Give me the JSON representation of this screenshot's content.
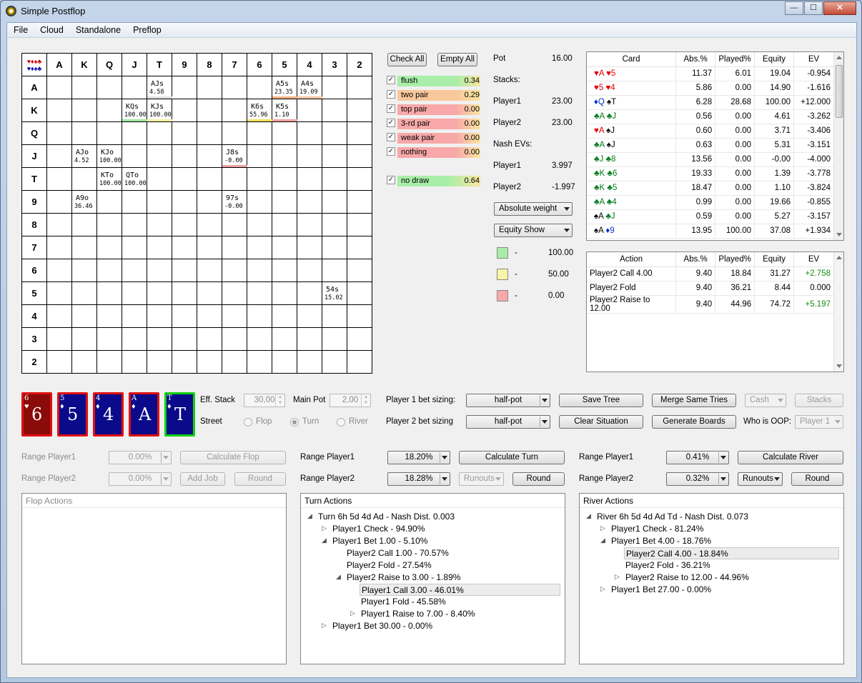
{
  "window": {
    "title": "Simple Postflop",
    "min": "—",
    "max": "☐",
    "close": "✕"
  },
  "menu": [
    "File",
    "Cloud",
    "Standalone",
    "Preflop"
  ],
  "grid": {
    "ranks": [
      "A",
      "K",
      "Q",
      "J",
      "T",
      "9",
      "8",
      "7",
      "6",
      "5",
      "4",
      "3",
      "2"
    ],
    "corner_suits": [
      "♥♦♠♣",
      "♥♦♠♣"
    ],
    "cells": [
      {
        "r": 0,
        "c": 4,
        "name": "AJs",
        "val": "4.58",
        "bar": "#e0e0e0"
      },
      {
        "r": 0,
        "c": 9,
        "name": "A5s",
        "val": "23.35",
        "bar": "#f6b080"
      },
      {
        "r": 0,
        "c": 10,
        "name": "A4s",
        "val": "19.09",
        "bar": "#f8c4a0"
      },
      {
        "r": 1,
        "c": 3,
        "name": "KQs",
        "val": "100.00",
        "bar": "#a0e8a0"
      },
      {
        "r": 1,
        "c": 4,
        "name": "KJs",
        "val": "100.00",
        "bar": "#f6f0a0"
      },
      {
        "r": 1,
        "c": 8,
        "name": "K6s",
        "val": "55.96",
        "bar": "#f0e060"
      },
      {
        "r": 1,
        "c": 9,
        "name": "K5s",
        "val": "1.10",
        "bar": "#f0a0a0"
      },
      {
        "r": 3,
        "c": 1,
        "name": "AJo",
        "val": "4.52",
        "bar": ""
      },
      {
        "r": 3,
        "c": 2,
        "name": "KJo",
        "val": "100.00",
        "bar": ""
      },
      {
        "r": 3,
        "c": 7,
        "name": "J8s",
        "val": "-0.00",
        "bar": "#f0a0a0"
      },
      {
        "r": 4,
        "c": 2,
        "name": "KTo",
        "val": "100.00",
        "bar": ""
      },
      {
        "r": 4,
        "c": 3,
        "name": "QTo",
        "val": "100.00",
        "bar": ""
      },
      {
        "r": 5,
        "c": 1,
        "name": "A9o",
        "val": "36.46",
        "bar": ""
      },
      {
        "r": 5,
        "c": 7,
        "name": "97s",
        "val": "-0.00",
        "bar": ""
      },
      {
        "r": 9,
        "c": 11,
        "name": "54s",
        "val": "15.02",
        "bar": ""
      }
    ]
  },
  "filters": {
    "check_all": "Check All",
    "empty_all": "Empty All",
    "items": [
      {
        "label": "flush",
        "value": "0.34",
        "color": "#a8eea8"
      },
      {
        "label": "two pair",
        "value": "0.29",
        "color": "#f8c89c"
      },
      {
        "label": "top pair",
        "value": "0.00",
        "color": "#f8a8a8"
      },
      {
        "label": "3-rd pair",
        "value": "0.00",
        "color": "#f8a8a8"
      },
      {
        "label": "weak pair",
        "value": "0.00",
        "color": "#f8a8a8"
      },
      {
        "label": "nothing",
        "value": "0.00",
        "color": "#f8a8a8"
      }
    ],
    "draw": {
      "label": "no draw",
      "value": "0.64",
      "color": "#a8eea8"
    }
  },
  "info": {
    "pot_label": "Pot",
    "pot": "16.00",
    "stacks_label": "Stacks:",
    "p1_label": "Player1",
    "p1_stack": "23.00",
    "p2_label": "Player2",
    "p2_stack": "23.00",
    "nash_label": "Nash EVs:",
    "p1_nash": "3.997",
    "p2_nash": "-1.997",
    "weight_select": "Absolute weight",
    "equity_select": "Equity Show",
    "legend": [
      {
        "color": "#a8eea8",
        "dash": "-",
        "value": "100.00"
      },
      {
        "color": "#f8f4a8",
        "dash": "-",
        "value": "50.00"
      },
      {
        "color": "#f8a8a8",
        "dash": "-",
        "value": "0.00"
      }
    ]
  },
  "card_table": {
    "headers": [
      "Card",
      "Abs.%",
      "Played%",
      "Equity",
      "EV"
    ],
    "rows": [
      {
        "c1": "♥A",
        "c1c": "red",
        "c2": "♥5",
        "c2c": "red",
        "abs": "11.37",
        "played": "6.01",
        "equity": "19.04",
        "ev": "-0.954"
      },
      {
        "c1": "♥5",
        "c1c": "red",
        "c2": "♥4",
        "c2c": "red",
        "abs": "5.86",
        "played": "0.00",
        "equity": "14.90",
        "ev": "-1.616"
      },
      {
        "c1": "♦Q",
        "c1c": "blu",
        "c2": "♠T",
        "c2c": "blk",
        "abs": "6.28",
        "played": "28.68",
        "equity": "100.00",
        "ev": "+12.000"
      },
      {
        "c1": "♣A",
        "c1c": "grn",
        "c2": "♣J",
        "c2c": "grn",
        "abs": "0.56",
        "played": "0.00",
        "equity": "4.61",
        "ev": "-3.262"
      },
      {
        "c1": "♥A",
        "c1c": "red",
        "c2": "♠J",
        "c2c": "blk",
        "abs": "0.60",
        "played": "0.00",
        "equity": "3.71",
        "ev": "-3.406"
      },
      {
        "c1": "♣A",
        "c1c": "grn",
        "c2": "♠J",
        "c2c": "blk",
        "abs": "0.63",
        "played": "0.00",
        "equity": "5.31",
        "ev": "-3.151"
      },
      {
        "c1": "♣J",
        "c1c": "grn",
        "c2": "♣8",
        "c2c": "grn",
        "abs": "13.56",
        "played": "0.00",
        "equity": "-0.00",
        "ev": "-4.000"
      },
      {
        "c1": "♣K",
        "c1c": "grn",
        "c2": "♣6",
        "c2c": "grn",
        "abs": "19.33",
        "played": "0.00",
        "equity": "1.39",
        "ev": "-3.778"
      },
      {
        "c1": "♣K",
        "c1c": "grn",
        "c2": "♣5",
        "c2c": "grn",
        "abs": "18.47",
        "played": "0.00",
        "equity": "1.10",
        "ev": "-3.824"
      },
      {
        "c1": "♣A",
        "c1c": "grn",
        "c2": "♣4",
        "c2c": "grn",
        "abs": "0.99",
        "played": "0.00",
        "equity": "19.66",
        "ev": "-0.855"
      },
      {
        "c1": "♠A",
        "c1c": "blk",
        "c2": "♣J",
        "c2c": "grn",
        "abs": "0.59",
        "played": "0.00",
        "equity": "5.27",
        "ev": "-3.157"
      },
      {
        "c1": "♠A",
        "c1c": "blk",
        "c2": "♦9",
        "c2c": "blu",
        "abs": "13.95",
        "played": "100.00",
        "equity": "37.08",
        "ev": "+1.934"
      }
    ]
  },
  "action_table": {
    "headers": [
      "Action",
      "Abs.%",
      "Played%",
      "Equity",
      "EV"
    ],
    "rows": [
      {
        "action": "Player2 Call 4.00",
        "abs": "9.40",
        "played": "18.84",
        "equity": "31.27",
        "ev": "+2.758",
        "pos": true
      },
      {
        "action": "Player2 Fold",
        "abs": "9.40",
        "played": "36.21",
        "equity": "8.44",
        "ev": "0.000",
        "pos": false
      },
      {
        "action": "Player2 Raise to 12.00",
        "abs": "9.40",
        "played": "44.96",
        "equity": "74.72",
        "ev": "+5.197",
        "pos": true
      }
    ]
  },
  "board": [
    {
      "rank": "6",
      "suit": "♥",
      "big": "6",
      "bg": "#8b0a0a",
      "border": "#e01010"
    },
    {
      "rank": "5",
      "suit": "♦",
      "big": "5",
      "bg": "#0a0a8b",
      "border": "#e01010"
    },
    {
      "rank": "4",
      "suit": "♦",
      "big": "4",
      "bg": "#0a0a8b",
      "border": "#e01010"
    },
    {
      "rank": "A",
      "suit": "♦",
      "big": "A",
      "bg": "#0a0a8b",
      "border": "#e01010"
    },
    {
      "rank": "T",
      "suit": "♦",
      "big": "T",
      "bg": "#0a0a8b",
      "border": "#10d010"
    }
  ],
  "controls": {
    "eff_stack_label": "Eff. Stack",
    "eff_stack": "30,00",
    "main_pot_label": "Main Pot",
    "main_pot": "2,00",
    "street_label": "Street",
    "street_flop": "Flop",
    "street_turn": "Turn",
    "street_river": "River",
    "p1_sizing_label": "Player 1 bet sizing:",
    "p1_sizing": "half-pot",
    "p2_sizing_label": "Player 2 bet sizing",
    "p2_sizing": "half-pot",
    "save_tree": "Save Tree",
    "clear_situation": "Clear Situation",
    "merge": "Merge Same Tries",
    "generate": "Generate Boards",
    "cash": "Cash",
    "stacks": "Stacks",
    "oop_label": "Who is OOP:",
    "oop": "Player 1"
  },
  "flop": {
    "range1_label": "Range Player1",
    "range1": "0.00%",
    "range2_label": "Range Player2",
    "range2": "0.00%",
    "calc": "Calculate Flop",
    "add_job": "Add Job",
    "round": "Round",
    "panel_title": "Flop Actions"
  },
  "turn": {
    "range1_label": "Range Player1",
    "range1": "18.20%",
    "range2_label": "Range Player2",
    "range2": "18.28%",
    "calc": "Calculate Turn",
    "runouts": "Runouts",
    "round": "Round",
    "panel_title": "Turn Actions",
    "nodes": [
      "Turn 6h 5d 4d Ad - Nash Dist. 0.003",
      "Player1 Check - 94.90%",
      "Player1 Bet 1.00 - 5.10%",
      "Player2 Call 1.00 - 70.57%",
      "Player2 Fold - 27.54%",
      "Player2 Raise to 3.00 - 1.89%",
      "Player1 Call 3.00 - 46.01%",
      "Player1 Fold - 45.58%",
      "Player1 Raise to 7.00 - 8.40%",
      "Player1 Bet 30.00 - 0.00%"
    ]
  },
  "river": {
    "range1_label": "Range Player1",
    "range1": "0.41%",
    "range2_label": "Range Player2",
    "range2": "0.32%",
    "calc": "Calculate River",
    "runouts": "Runouts",
    "round": "Round",
    "panel_title": "River Actions",
    "nodes": [
      "River 6h 5d 4d Ad Td - Nash Dist. 0.073",
      "Player1 Check - 81.24%",
      "Player1 Bet 4.00 - 18.76%",
      "Player2 Call 4.00 - 18.84%",
      "Player2 Fold - 36.21%",
      "Player2 Raise to 12.00 - 44.96%",
      "Player1 Bet 27.00 - 0.00%"
    ]
  }
}
